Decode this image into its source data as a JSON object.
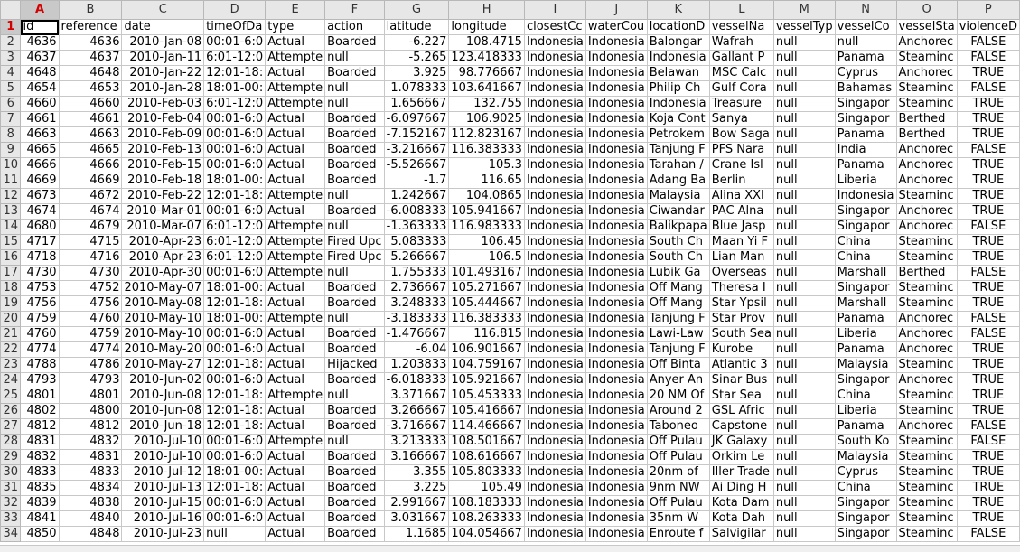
{
  "sheet": {
    "active_cell": "A1",
    "columns": [
      "A",
      "B",
      "C",
      "D",
      "E",
      "F",
      "G",
      "H",
      "I",
      "J",
      "K",
      "L",
      "M",
      "N",
      "O",
      "P"
    ],
    "header_row": {
      "row_label": "1",
      "values": [
        "id",
        "reference",
        "date",
        "timeOfDa",
        "type",
        "action",
        "latitude",
        "longitude",
        "closestCc",
        "waterCou",
        "locationD",
        "vesselNa",
        "vesselTyp",
        "vesselCo",
        "vesselSta",
        "violenceD"
      ]
    },
    "rows": [
      {
        "n": "2",
        "v": [
          "4636",
          "4636",
          "2010-Jan-08",
          "00:01-6:0",
          "Actual",
          "Boarded",
          "-6.227",
          "108.4715",
          "Indonesia",
          "Indonesia",
          "Balongar",
          "Wafrah",
          "null",
          "null",
          "Anchorec",
          "FALSE"
        ]
      },
      {
        "n": "3",
        "v": [
          "4637",
          "4637",
          "2010-Jan-11",
          "6:01-12:0",
          "Attempte",
          "null",
          "-5.265",
          "123.418333",
          "Indonesia",
          "Indonesia",
          "Indonesia",
          "Gallant P",
          "null",
          "Panama",
          "Steaminc",
          "FALSE"
        ]
      },
      {
        "n": "4",
        "v": [
          "4648",
          "4648",
          "2010-Jan-22",
          "12:01-18:",
          "Actual",
          "Boarded",
          "3.925",
          "98.776667",
          "Indonesia",
          "Indonesia",
          "Belawan",
          "MSC Calc",
          "null",
          "Cyprus",
          "Anchorec",
          "TRUE"
        ]
      },
      {
        "n": "5",
        "v": [
          "4654",
          "4653",
          "2010-Jan-28",
          "18:01-00:",
          "Attempte",
          "null",
          "1.078333",
          "103.641667",
          "Indonesia",
          "Indonesia",
          "Philip Ch",
          "Gulf Cora",
          "null",
          "Bahamas",
          "Steaminc",
          "FALSE"
        ]
      },
      {
        "n": "6",
        "v": [
          "4660",
          "4660",
          "2010-Feb-03",
          "6:01-12:0",
          "Attempte",
          "null",
          "1.656667",
          "132.755",
          "Indonesia",
          "Indonesia",
          "Indonesia",
          "Treasure",
          "null",
          "Singapor",
          "Steaminc",
          "TRUE"
        ]
      },
      {
        "n": "7",
        "v": [
          "4661",
          "4661",
          "2010-Feb-04",
          "00:01-6:0",
          "Actual",
          "Boarded",
          "-6.097667",
          "106.9025",
          "Indonesia",
          "Indonesia",
          "Koja Cont",
          "Sanya",
          "null",
          "Singapor",
          "Berthed",
          "TRUE"
        ]
      },
      {
        "n": "8",
        "v": [
          "4663",
          "4663",
          "2010-Feb-09",
          "00:01-6:0",
          "Actual",
          "Boarded",
          "-7.152167",
          "112.823167",
          "Indonesia",
          "Indonesia",
          "Petrokem",
          "Bow Saga",
          "null",
          "Panama",
          "Berthed",
          "TRUE"
        ]
      },
      {
        "n": "9",
        "v": [
          "4665",
          "4665",
          "2010-Feb-13",
          "00:01-6:0",
          "Actual",
          "Boarded",
          "-3.216667",
          "116.383333",
          "Indonesia",
          "Indonesia",
          "Tanjung F",
          "PFS Nara",
          "null",
          "India",
          "Anchorec",
          "FALSE"
        ]
      },
      {
        "n": "10",
        "v": [
          "4666",
          "4666",
          "2010-Feb-15",
          "00:01-6:0",
          "Actual",
          "Boarded",
          "-5.526667",
          "105.3",
          "Indonesia",
          "Indonesia",
          "Tarahan /",
          "Crane Isl",
          "null",
          "Panama",
          "Anchorec",
          "TRUE"
        ]
      },
      {
        "n": "11",
        "v": [
          "4669",
          "4669",
          "2010-Feb-18",
          "18:01-00:",
          "Actual",
          "Boarded",
          "-1.7",
          "116.65",
          "Indonesia",
          "Indonesia",
          "Adang Ba",
          "Berlin",
          "null",
          "Liberia",
          "Anchorec",
          "TRUE"
        ]
      },
      {
        "n": "12",
        "v": [
          "4673",
          "4672",
          "2010-Feb-22",
          "12:01-18:",
          "Attempte",
          "null",
          "1.242667",
          "104.0865",
          "Indonesia",
          "Indonesia",
          "Malaysia",
          "Alina XXI",
          "null",
          "Indonesia",
          "Steaminc",
          "TRUE"
        ]
      },
      {
        "n": "13",
        "v": [
          "4674",
          "4674",
          "2010-Mar-01",
          "00:01-6:0",
          "Actual",
          "Boarded",
          "-6.008333",
          "105.941667",
          "Indonesia",
          "Indonesia",
          "Ciwandar",
          "PAC Alna",
          "null",
          "Singapor",
          "Anchorec",
          "TRUE"
        ]
      },
      {
        "n": "14",
        "v": [
          "4680",
          "4679",
          "2010-Mar-07",
          "6:01-12:0",
          "Attempte",
          "null",
          "-1.363333",
          "116.983333",
          "Indonesia",
          "Indonesia",
          "Balikpapa",
          "Blue Jasp",
          "null",
          "Singapor",
          "Anchorec",
          "FALSE"
        ]
      },
      {
        "n": "15",
        "v": [
          "4717",
          "4715",
          "2010-Apr-23",
          "6:01-12:0",
          "Attempte",
          "Fired Upc",
          "5.083333",
          "106.45",
          "Indonesia",
          "Indonesia",
          "South Ch",
          "Maan Yi F",
          "null",
          "China",
          "Steaminc",
          "TRUE"
        ]
      },
      {
        "n": "16",
        "v": [
          "4718",
          "4716",
          "2010-Apr-23",
          "6:01-12:0",
          "Attempte",
          "Fired Upc",
          "5.266667",
          "106.5",
          "Indonesia",
          "Indonesia",
          "South Ch",
          "Lian Man",
          "null",
          "China",
          "Steaminc",
          "TRUE"
        ]
      },
      {
        "n": "17",
        "v": [
          "4730",
          "4730",
          "2010-Apr-30",
          "00:01-6:0",
          "Attempte",
          "null",
          "1.755333",
          "101.493167",
          "Indonesia",
          "Indonesia",
          "Lubik Ga",
          "Overseas",
          "null",
          "Marshall",
          "Berthed",
          "FALSE"
        ]
      },
      {
        "n": "18",
        "v": [
          "4753",
          "4752",
          "2010-May-07",
          "18:01-00:",
          "Actual",
          "Boarded",
          "2.736667",
          "105.271667",
          "Indonesia",
          "Indonesia",
          "Off Mang",
          "Theresa I",
          "null",
          "Singapor",
          "Steaminc",
          "TRUE"
        ]
      },
      {
        "n": "19",
        "v": [
          "4756",
          "4756",
          "2010-May-08",
          "12:01-18:",
          "Actual",
          "Boarded",
          "3.248333",
          "105.444667",
          "Indonesia",
          "Indonesia",
          "Off Mang",
          "Star Ypsil",
          "null",
          "Marshall",
          "Steaminc",
          "TRUE"
        ]
      },
      {
        "n": "20",
        "v": [
          "4759",
          "4760",
          "2010-May-10",
          "18:01-00:",
          "Attempte",
          "null",
          "-3.183333",
          "116.383333",
          "Indonesia",
          "Indonesia",
          "Tanjung F",
          "Star Prov",
          "null",
          "Panama",
          "Anchorec",
          "FALSE"
        ]
      },
      {
        "n": "21",
        "v": [
          "4760",
          "4759",
          "2010-May-10",
          "00:01-6:0",
          "Actual",
          "Boarded",
          "-1.476667",
          "116.815",
          "Indonesia",
          "Indonesia",
          "Lawi-Law",
          "South Sea",
          "null",
          "Liberia",
          "Anchorec",
          "FALSE"
        ]
      },
      {
        "n": "22",
        "v": [
          "4774",
          "4774",
          "2010-May-20",
          "00:01-6:0",
          "Actual",
          "Boarded",
          "-6.04",
          "106.901667",
          "Indonesia",
          "Indonesia",
          "Tanjung F",
          "Kurobe",
          "null",
          "Panama",
          "Anchorec",
          "TRUE"
        ]
      },
      {
        "n": "23",
        "v": [
          "4788",
          "4786",
          "2010-May-27",
          "12:01-18:",
          "Actual",
          "Hijacked",
          "1.203833",
          "104.759167",
          "Indonesia",
          "Indonesia",
          "Off Binta",
          "Atlantic 3",
          "null",
          "Malaysia",
          "Steaminc",
          "TRUE"
        ]
      },
      {
        "n": "24",
        "v": [
          "4793",
          "4793",
          "2010-Jun-02",
          "00:01-6:0",
          "Actual",
          "Boarded",
          "-6.018333",
          "105.921667",
          "Indonesia",
          "Indonesia",
          "Anyer An",
          "Sinar Bus",
          "null",
          "Singapor",
          "Anchorec",
          "TRUE"
        ]
      },
      {
        "n": "25",
        "v": [
          "4801",
          "4801",
          "2010-Jun-08",
          "12:01-18:",
          "Attempte",
          "null",
          "3.371667",
          "105.453333",
          "Indonesia",
          "Indonesia",
          "20 NM Of",
          "Star Sea",
          "null",
          "China",
          "Steaminc",
          "TRUE"
        ]
      },
      {
        "n": "26",
        "v": [
          "4802",
          "4800",
          "2010-Jun-08",
          "12:01-18:",
          "Actual",
          "Boarded",
          "3.266667",
          "105.416667",
          "Indonesia",
          "Indonesia",
          "Around 2",
          "GSL Afric",
          "null",
          "Liberia",
          "Steaminc",
          "TRUE"
        ]
      },
      {
        "n": "27",
        "v": [
          "4812",
          "4812",
          "2010-Jun-18",
          "12:01-18:",
          "Actual",
          "Boarded",
          "-3.716667",
          "114.466667",
          "Indonesia",
          "Indonesia",
          "Taboneo",
          "Capstone",
          "null",
          "Panama",
          "Anchorec",
          "FALSE"
        ]
      },
      {
        "n": "28",
        "v": [
          "4831",
          "4832",
          "2010-Jul-10",
          "00:01-6:0",
          "Attempte",
          "null",
          "3.213333",
          "108.501667",
          "Indonesia",
          "Indonesia",
          "Off Pulau",
          "JK Galaxy",
          "null",
          "South Ko",
          "Steaminc",
          "FALSE"
        ]
      },
      {
        "n": "29",
        "v": [
          "4832",
          "4831",
          "2010-Jul-10",
          "00:01-6:0",
          "Actual",
          "Boarded",
          "3.166667",
          "108.616667",
          "Indonesia",
          "Indonesia",
          "Off Pulau",
          "Orkim Le",
          "null",
          "Malaysia",
          "Steaminc",
          "TRUE"
        ]
      },
      {
        "n": "30",
        "v": [
          "4833",
          "4833",
          "2010-Jul-12",
          "18:01-00:",
          "Actual",
          "Boarded",
          "3.355",
          "105.803333",
          "Indonesia",
          "Indonesia",
          "20nm of",
          "Iller Trade",
          "null",
          "Cyprus",
          "Steaminc",
          "TRUE"
        ]
      },
      {
        "n": "31",
        "v": [
          "4835",
          "4834",
          "2010-Jul-13",
          "12:01-18:",
          "Actual",
          "Boarded",
          "3.225",
          "105.49",
          "Indonesia",
          "Indonesia",
          "9nm NW",
          "Ai Ding H",
          "null",
          "China",
          "Steaminc",
          "TRUE"
        ]
      },
      {
        "n": "32",
        "v": [
          "4839",
          "4838",
          "2010-Jul-15",
          "00:01-6:0",
          "Actual",
          "Boarded",
          "2.991667",
          "108.183333",
          "Indonesia",
          "Indonesia",
          "Off Pulau",
          "Kota Dam",
          "null",
          "Singapor",
          "Steaminc",
          "TRUE"
        ]
      },
      {
        "n": "33",
        "v": [
          "4841",
          "4840",
          "2010-Jul-16",
          "00:01-6:0",
          "Actual",
          "Boarded",
          "3.031667",
          "108.263333",
          "Indonesia",
          "Indonesia",
          "35nm W",
          "Kota Dah",
          "null",
          "Singapor",
          "Steaminc",
          "TRUE"
        ]
      },
      {
        "n": "34",
        "v": [
          "4850",
          "4848",
          "2010-Jul-23",
          "null",
          "Actual",
          "Boarded",
          "1.1685",
          "104.054667",
          "Indonesia",
          "Indonesia",
          "Enroute f",
          "Salvigilar",
          "null",
          "Singapor",
          "Steaminc",
          "FALSE"
        ]
      }
    ]
  }
}
